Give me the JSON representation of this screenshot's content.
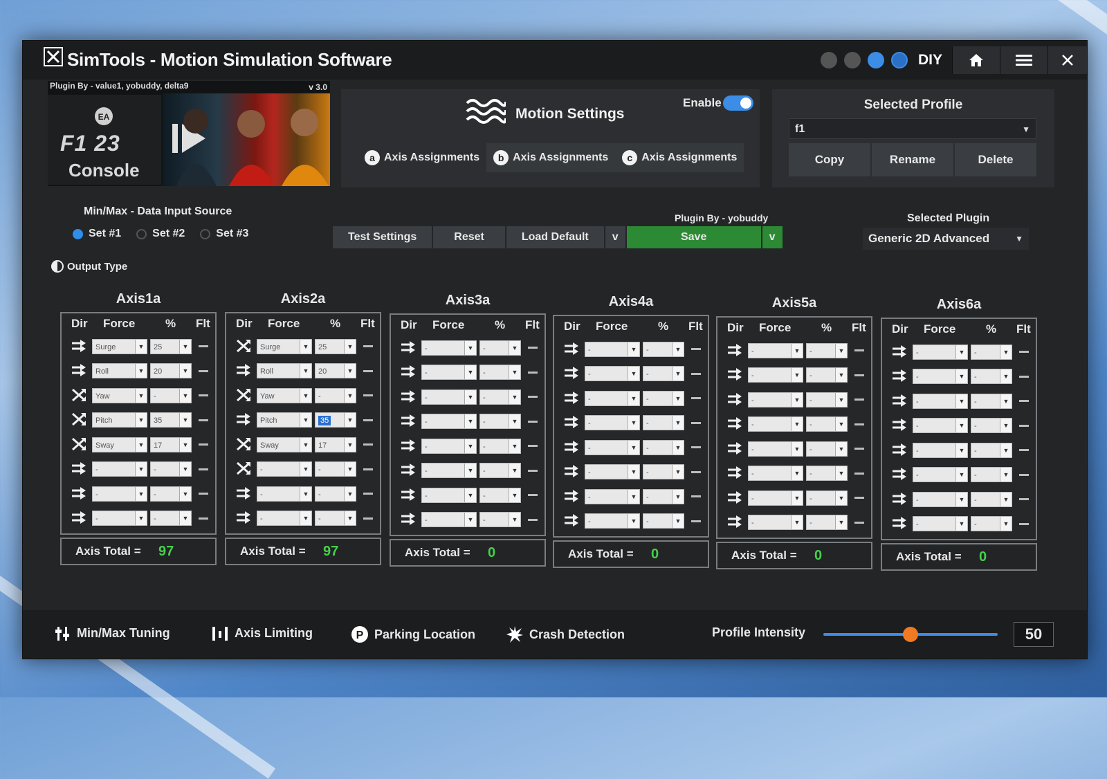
{
  "window": {
    "title": "SimTools - Motion Simulation Software",
    "diy_label": "DIY"
  },
  "banner": {
    "credit": "Plugin By - value1, yobuddy, delta9",
    "version": "v 3.0",
    "game_brand": "F1 23",
    "game_edition": "Console"
  },
  "motion": {
    "title": "Motion Settings",
    "enable_label": "Enable",
    "enabled": true,
    "tabs": [
      {
        "badge": "a",
        "label": "Axis Assignments"
      },
      {
        "badge": "b",
        "label": "Axis Assignments"
      },
      {
        "badge": "c",
        "label": "Axis Assignments"
      }
    ]
  },
  "profile": {
    "title": "Selected Profile",
    "value": "f1",
    "buttons": {
      "copy": "Copy",
      "rename": "Rename",
      "delete": "Delete"
    }
  },
  "input_source": {
    "title": "Min/Max - Data Input Source",
    "sets": [
      "Set #1",
      "Set #2",
      "Set #3"
    ],
    "selected": 0,
    "output_type": "Output Type"
  },
  "actions": {
    "test": "Test Settings",
    "reset": "Reset",
    "load_default": "Load Default",
    "caret": "v",
    "save": "Save",
    "plugin_by": "Plugin By - yobuddy"
  },
  "plugin": {
    "title": "Selected Plugin",
    "value": "Generic 2D Advanced"
  },
  "columns": {
    "dir": "Dir",
    "force": "Force",
    "pct": "%",
    "flt": "Flt"
  },
  "total_label": "Axis Total =",
  "axes": [
    {
      "name": "Axis1a",
      "total": "97",
      "rows": [
        {
          "dir": "normal",
          "force": "Surge",
          "pct": "25"
        },
        {
          "dir": "normal",
          "force": "Roll",
          "pct": "20"
        },
        {
          "dir": "inverted",
          "force": "Yaw",
          "pct": "-"
        },
        {
          "dir": "inverted",
          "force": "Pitch",
          "pct": "35"
        },
        {
          "dir": "inverted",
          "force": "Sway",
          "pct": "17"
        },
        {
          "dir": "normal",
          "force": "-",
          "pct": "-"
        },
        {
          "dir": "normal",
          "force": "-",
          "pct": "-"
        },
        {
          "dir": "normal",
          "force": "-",
          "pct": "-"
        }
      ]
    },
    {
      "name": "Axis2a",
      "total": "97",
      "rows": [
        {
          "dir": "inverted",
          "force": "Surge",
          "pct": "25"
        },
        {
          "dir": "normal",
          "force": "Roll",
          "pct": "20"
        },
        {
          "dir": "inverted",
          "force": "Yaw",
          "pct": "-"
        },
        {
          "dir": "normal",
          "force": "Pitch",
          "pct": "35",
          "highlight": true
        },
        {
          "dir": "inverted",
          "force": "Sway",
          "pct": "17"
        },
        {
          "dir": "inverted",
          "force": "-",
          "pct": "-"
        },
        {
          "dir": "normal",
          "force": "-",
          "pct": "-"
        },
        {
          "dir": "normal",
          "force": "-",
          "pct": "-"
        }
      ]
    },
    {
      "name": "Axis3a",
      "total": "0",
      "rows": [
        {
          "dir": "normal",
          "force": "-",
          "pct": "-"
        },
        {
          "dir": "normal",
          "force": "-",
          "pct": "-"
        },
        {
          "dir": "normal",
          "force": "-",
          "pct": "-"
        },
        {
          "dir": "normal",
          "force": "-",
          "pct": "-"
        },
        {
          "dir": "normal",
          "force": "-",
          "pct": "-"
        },
        {
          "dir": "normal",
          "force": "-",
          "pct": "-"
        },
        {
          "dir": "normal",
          "force": "-",
          "pct": "-"
        },
        {
          "dir": "normal",
          "force": "-",
          "pct": "-"
        }
      ]
    },
    {
      "name": "Axis4a",
      "total": "0",
      "rows": [
        {
          "dir": "normal",
          "force": "-",
          "pct": "-"
        },
        {
          "dir": "normal",
          "force": "-",
          "pct": "-"
        },
        {
          "dir": "normal",
          "force": "-",
          "pct": "-"
        },
        {
          "dir": "normal",
          "force": "-",
          "pct": "-"
        },
        {
          "dir": "normal",
          "force": "-",
          "pct": "-"
        },
        {
          "dir": "normal",
          "force": "-",
          "pct": "-"
        },
        {
          "dir": "normal",
          "force": "-",
          "pct": "-"
        },
        {
          "dir": "normal",
          "force": "-",
          "pct": "-"
        }
      ]
    },
    {
      "name": "Axis5a",
      "total": "0",
      "rows": [
        {
          "dir": "normal",
          "force": "-",
          "pct": "-"
        },
        {
          "dir": "normal",
          "force": "-",
          "pct": "-"
        },
        {
          "dir": "normal",
          "force": "-",
          "pct": "-"
        },
        {
          "dir": "normal",
          "force": "-",
          "pct": "-"
        },
        {
          "dir": "normal",
          "force": "-",
          "pct": "-"
        },
        {
          "dir": "normal",
          "force": "-",
          "pct": "-"
        },
        {
          "dir": "normal",
          "force": "-",
          "pct": "-"
        },
        {
          "dir": "normal",
          "force": "-",
          "pct": "-"
        }
      ]
    },
    {
      "name": "Axis6a",
      "total": "0",
      "rows": [
        {
          "dir": "normal",
          "force": "-",
          "pct": "-"
        },
        {
          "dir": "normal",
          "force": "-",
          "pct": "-"
        },
        {
          "dir": "normal",
          "force": "-",
          "pct": "-"
        },
        {
          "dir": "normal",
          "force": "-",
          "pct": "-"
        },
        {
          "dir": "normal",
          "force": "-",
          "pct": "-"
        },
        {
          "dir": "normal",
          "force": "-",
          "pct": "-"
        },
        {
          "dir": "normal",
          "force": "-",
          "pct": "-"
        },
        {
          "dir": "normal",
          "force": "-",
          "pct": "-"
        }
      ]
    }
  ],
  "bottom": {
    "minmax": "Min/Max Tuning",
    "limiting": "Axis Limiting",
    "parking": "Parking Location",
    "crash": "Crash Detection",
    "intensity_label": "Profile Intensity",
    "intensity": 50,
    "intensity_max": 100
  },
  "colors": {
    "accent": "#3b8de6",
    "save": "#2c8a34",
    "total": "#46d14a",
    "slider_knob": "#f07a22"
  }
}
